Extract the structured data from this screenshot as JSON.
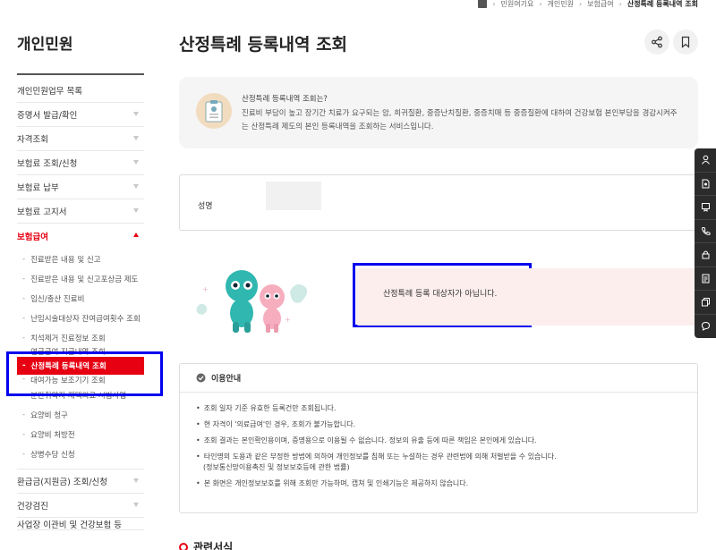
{
  "breadcrumb": [
    "민원여기요",
    "개인민원",
    "보험급여",
    "산정특례 등록내역 조회"
  ],
  "sidebar": {
    "title": "개인민원",
    "items": [
      {
        "label": "개인민원업무 목록",
        "chevron": false
      },
      {
        "label": "증명서 발급/확인",
        "chevron": true
      },
      {
        "label": "자격조회",
        "chevron": true
      },
      {
        "label": "보험료 조회/신청",
        "chevron": true
      },
      {
        "label": "보험료 납부",
        "chevron": true
      },
      {
        "label": "보험료 고지서",
        "chevron": true
      },
      {
        "label": "보험급여",
        "chevron": true,
        "active": true
      }
    ],
    "sub_items": [
      "진료받은 내용 및 신고",
      "진료받은 내용 및 신고포상금 제도",
      "임신/출산 진료비",
      "난임시술대상자 잔여급여횟수 조회",
      "치석제거 진료정보 조회",
      "연금급여 지급내역 조회",
      "산정특례 등록내역 조회",
      "대여가능 보조기기 조회",
      "분만취약지 재택의료 시범사업",
      "요양비 청구",
      "요양비 처방전",
      "상병수당 신청"
    ],
    "current_sub": "산정특례 등록내역 조회",
    "after_items": [
      {
        "label": "환급금(지원금) 조회/신청",
        "chevron": true
      },
      {
        "label": "건강검진",
        "chevron": true
      },
      {
        "label": "사업장 이관비 및 건강보험 등",
        "chevron": false
      }
    ]
  },
  "page": {
    "title": "산정특례 등록내역 조회",
    "share_icon": "share-icon",
    "bookmark_icon": "bookmark-icon"
  },
  "intro": {
    "question": "산정특례 등록내역 조회는?",
    "description": "진료비 부담이 높고 장기간 치료가 요구되는 암, 희귀질환, 중증난치질환, 중증치매 등 중증질환에 대하여 건강보험 본인부담을 경감시켜주는 산정특례 제도의 본인 등록내역을 조회하는 서비스입니다."
  },
  "form": {
    "name_label": "성명"
  },
  "result": {
    "message": "산정특례 등록 대상자가 아닙니다."
  },
  "guide": {
    "title": "이용안내",
    "items": [
      {
        "text": "조회 일자 기준 유효한 등록건만 조회됩니다.",
        "cont": ""
      },
      {
        "text": "현 자격이 '의료급여'인 경우, 조회가 불가능합니다.",
        "cont": ""
      },
      {
        "text": "조회 결과는 본인확인용이며, 증명용으로 이용될 수 없습니다. 정보의 유출 등에 따른 책임은 본인에게 있습니다.",
        "cont": ""
      },
      {
        "text": "타인명의 도용과 같은 부정한 방법에 의하여 개인정보를 침해 또는 누설하는 경우 관련법에 의해 처벌받을 수 있습니다.",
        "cont": "(정보통신망이용촉진 및 정보보호등에 관한 법률)"
      },
      {
        "text": "본 화면은 개인정보보호를 위해 조회만 가능하며, 캡쳐 및 인쇄기능은 제공하지 않습니다.",
        "cont": ""
      }
    ]
  },
  "related": {
    "title": "관련서식"
  },
  "quickbar": {
    "icons": [
      "person-icon",
      "document-icon",
      "certificate-icon",
      "phone-icon",
      "lock-icon",
      "list-icon",
      "copy-icon",
      "chat-icon"
    ]
  },
  "colors": {
    "accent": "#e60012",
    "highlight_box": "#0000ee",
    "intro_bg": "#f5f5f5",
    "result_bg": "#fdeeee",
    "quickbar_bg": "#2b2b2b"
  }
}
